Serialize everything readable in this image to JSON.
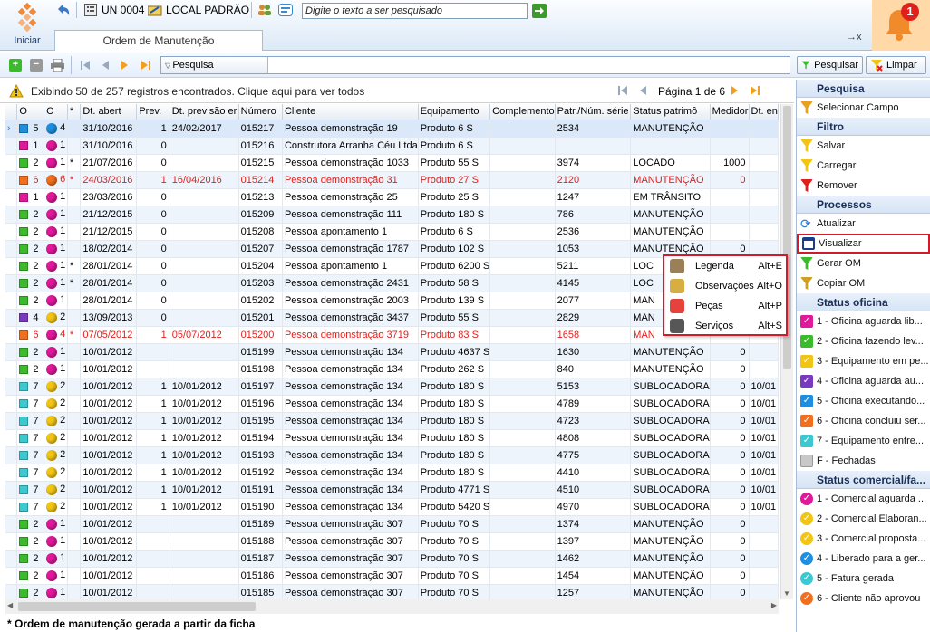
{
  "top": {
    "iniciar": "Iniciar",
    "unit": "UN 0004",
    "location": "LOCAL PADRÃO",
    "search_placeholder": "Digite o texto a ser pesquisado",
    "tab": "Ordem de Manutenção",
    "notif_count": "1",
    "tab_controls": "→x"
  },
  "toolbar": {
    "search_label": "Pesquisa",
    "search_btn": "Pesquisar",
    "clear_btn": "Limpar"
  },
  "info": {
    "text": "Exibindo 50 de 257 registros encontrados. Clique aqui para ver todos",
    "page": "Página 1 de 6"
  },
  "columns": [
    "O",
    "C",
    "*",
    "Dt. abert",
    "Prev.",
    "Dt. previsão er",
    "Número",
    "Cliente",
    "Equipamento",
    "Complemento",
    "Patr./Núm. série",
    "Status patrimô",
    "Medidor",
    "Dt. en"
  ],
  "colors": {
    "blue": "#1e8fe0",
    "magenta": "#e0189a",
    "green": "#3bbb2c",
    "orange": "#f07020",
    "purple": "#7a3ac0",
    "cyan": "#3cc8d0",
    "yellow": "#f2c514",
    "red": "#e0201b"
  },
  "rows": [
    {
      "o": "5",
      "oc": "blue",
      "c": "4",
      "cc": "blue",
      "star": "",
      "dt": "31/10/2016",
      "prev": "1",
      "dtp": "24/02/2017",
      "num": "015217",
      "cli": "Pessoa demonstração 19",
      "eq": "Produto 6 S",
      "comp": "",
      "patr": "2534",
      "status": "MANUTENÇÃO",
      "med": "",
      "dte": "",
      "sel": true
    },
    {
      "o": "1",
      "oc": "magenta",
      "c": "1",
      "cc": "magenta",
      "star": "",
      "dt": "31/10/2016",
      "prev": "0",
      "dtp": "",
      "num": "015216",
      "cli": "Construtora Arranha Céu Ltda",
      "eq": "Produto 6 S",
      "comp": "",
      "patr": "",
      "status": "",
      "med": "",
      "dte": ""
    },
    {
      "o": "2",
      "oc": "green",
      "c": "1",
      "cc": "magenta",
      "star": "*",
      "dt": "21/07/2016",
      "prev": "0",
      "dtp": "",
      "num": "015215",
      "cli": "Pessoa demonstração 1033",
      "eq": "Produto 55 S",
      "comp": "",
      "patr": "3974",
      "status": "LOCADO",
      "med": "1000",
      "dte": ""
    },
    {
      "o": "6",
      "oc": "orange",
      "c": "6",
      "cc": "orange",
      "star": "*",
      "dt": "24/03/2016",
      "prev": "1",
      "dtp": "16/04/2016",
      "num": "015214",
      "cli": "Pessoa demonstração 31",
      "eq": "Produto 27 S",
      "comp": "",
      "patr": "2120",
      "status": "MANUTENÇÃO",
      "med": "0",
      "dte": "",
      "red": true
    },
    {
      "o": "1",
      "oc": "magenta",
      "c": "1",
      "cc": "magenta",
      "star": "",
      "dt": "23/03/2016",
      "prev": "0",
      "dtp": "",
      "num": "015213",
      "cli": "Pessoa demonstração 25",
      "eq": "Produto 25 S",
      "comp": "",
      "patr": "1247",
      "status": "EM TRÂNSITO",
      "med": "",
      "dte": ""
    },
    {
      "o": "2",
      "oc": "green",
      "c": "1",
      "cc": "magenta",
      "star": "",
      "dt": "21/12/2015",
      "prev": "0",
      "dtp": "",
      "num": "015209",
      "cli": "Pessoa demonstração 111",
      "eq": "Produto 180 S",
      "comp": "",
      "patr": "786",
      "status": "MANUTENÇÃO",
      "med": "",
      "dte": ""
    },
    {
      "o": "2",
      "oc": "green",
      "c": "1",
      "cc": "magenta",
      "star": "",
      "dt": "21/12/2015",
      "prev": "0",
      "dtp": "",
      "num": "015208",
      "cli": "Pessoa apontamento 1",
      "eq": "Produto 6 S",
      "comp": "",
      "patr": "2536",
      "status": "MANUTENÇÃO",
      "med": "",
      "dte": ""
    },
    {
      "o": "2",
      "oc": "green",
      "c": "1",
      "cc": "magenta",
      "star": "",
      "dt": "18/02/2014",
      "prev": "0",
      "dtp": "",
      "num": "015207",
      "cli": "Pessoa demonstração 1787",
      "eq": "Produto 102 S",
      "comp": "",
      "patr": "1053",
      "status": "MANUTENÇÃO",
      "med": "0",
      "dte": ""
    },
    {
      "o": "2",
      "oc": "green",
      "c": "1",
      "cc": "magenta",
      "star": "*",
      "dt": "28/01/2014",
      "prev": "0",
      "dtp": "",
      "num": "015204",
      "cli": "Pessoa apontamento 1",
      "eq": "Produto 6200 S",
      "comp": "",
      "patr": "5211",
      "status": "LOC",
      "med": "",
      "dte": ""
    },
    {
      "o": "2",
      "oc": "green",
      "c": "1",
      "cc": "magenta",
      "star": "*",
      "dt": "28/01/2014",
      "prev": "0",
      "dtp": "",
      "num": "015203",
      "cli": "Pessoa demonstração 2431",
      "eq": "Produto 58 S",
      "comp": "",
      "patr": "4145",
      "status": "LOC",
      "med": "",
      "dte": ""
    },
    {
      "o": "2",
      "oc": "green",
      "c": "1",
      "cc": "magenta",
      "star": "",
      "dt": "28/01/2014",
      "prev": "0",
      "dtp": "",
      "num": "015202",
      "cli": "Pessoa demonstração 2003",
      "eq": "Produto 139 S",
      "comp": "",
      "patr": "2077",
      "status": "MAN",
      "med": "",
      "dte": ""
    },
    {
      "o": "4",
      "oc": "purple",
      "c": "2",
      "cc": "yellow",
      "star": "",
      "dt": "13/09/2013",
      "prev": "0",
      "dtp": "",
      "num": "015201",
      "cli": "Pessoa demonstração 3437",
      "eq": "Produto 55 S",
      "comp": "",
      "patr": "2829",
      "status": "MAN",
      "med": "",
      "dte": ""
    },
    {
      "o": "6",
      "oc": "orange",
      "c": "4",
      "cc": "magenta",
      "star": "*",
      "dt": "07/05/2012",
      "prev": "1",
      "dtp": "05/07/2012",
      "num": "015200",
      "cli": "Pessoa demonstração 3719",
      "eq": "Produto 83 S",
      "comp": "",
      "patr": "1658",
      "status": "MAN",
      "med": "",
      "dte": "",
      "red": true
    },
    {
      "o": "2",
      "oc": "green",
      "c": "1",
      "cc": "magenta",
      "star": "",
      "dt": "10/01/2012",
      "prev": "",
      "dtp": "",
      "num": "015199",
      "cli": "Pessoa demonstração 134",
      "eq": "Produto 4637 S",
      "comp": "",
      "patr": "1630",
      "status": "MANUTENÇÃO",
      "med": "0",
      "dte": ""
    },
    {
      "o": "2",
      "oc": "green",
      "c": "1",
      "cc": "magenta",
      "star": "",
      "dt": "10/01/2012",
      "prev": "",
      "dtp": "",
      "num": "015198",
      "cli": "Pessoa demonstração 134",
      "eq": "Produto 262 S",
      "comp": "",
      "patr": "840",
      "status": "MANUTENÇÃO",
      "med": "0",
      "dte": ""
    },
    {
      "o": "7",
      "oc": "cyan",
      "c": "2",
      "cc": "yellow",
      "star": "",
      "dt": "10/01/2012",
      "prev": "1",
      "dtp": "10/01/2012",
      "num": "015197",
      "cli": "Pessoa demonstração 134",
      "eq": "Produto 180 S",
      "comp": "",
      "patr": "5153",
      "status": "SUBLOCADORA",
      "med": "0",
      "dte": "10/01"
    },
    {
      "o": "7",
      "oc": "cyan",
      "c": "2",
      "cc": "yellow",
      "star": "",
      "dt": "10/01/2012",
      "prev": "1",
      "dtp": "10/01/2012",
      "num": "015196",
      "cli": "Pessoa demonstração 134",
      "eq": "Produto 180 S",
      "comp": "",
      "patr": "4789",
      "status": "SUBLOCADORA",
      "med": "0",
      "dte": "10/01"
    },
    {
      "o": "7",
      "oc": "cyan",
      "c": "2",
      "cc": "yellow",
      "star": "",
      "dt": "10/01/2012",
      "prev": "1",
      "dtp": "10/01/2012",
      "num": "015195",
      "cli": "Pessoa demonstração 134",
      "eq": "Produto 180 S",
      "comp": "",
      "patr": "4723",
      "status": "SUBLOCADORA",
      "med": "0",
      "dte": "10/01"
    },
    {
      "o": "7",
      "oc": "cyan",
      "c": "2",
      "cc": "yellow",
      "star": "",
      "dt": "10/01/2012",
      "prev": "1",
      "dtp": "10/01/2012",
      "num": "015194",
      "cli": "Pessoa demonstração 134",
      "eq": "Produto 180 S",
      "comp": "",
      "patr": "4808",
      "status": "SUBLOCADORA",
      "med": "0",
      "dte": "10/01"
    },
    {
      "o": "7",
      "oc": "cyan",
      "c": "2",
      "cc": "yellow",
      "star": "",
      "dt": "10/01/2012",
      "prev": "1",
      "dtp": "10/01/2012",
      "num": "015193",
      "cli": "Pessoa demonstração 134",
      "eq": "Produto 180 S",
      "comp": "",
      "patr": "4775",
      "status": "SUBLOCADORA",
      "med": "0",
      "dte": "10/01"
    },
    {
      "o": "7",
      "oc": "cyan",
      "c": "2",
      "cc": "yellow",
      "star": "",
      "dt": "10/01/2012",
      "prev": "1",
      "dtp": "10/01/2012",
      "num": "015192",
      "cli": "Pessoa demonstração 134",
      "eq": "Produto 180 S",
      "comp": "",
      "patr": "4410",
      "status": "SUBLOCADORA",
      "med": "0",
      "dte": "10/01"
    },
    {
      "o": "7",
      "oc": "cyan",
      "c": "2",
      "cc": "yellow",
      "star": "",
      "dt": "10/01/2012",
      "prev": "1",
      "dtp": "10/01/2012",
      "num": "015191",
      "cli": "Pessoa demonstração 134",
      "eq": "Produto 4771 S",
      "comp": "",
      "patr": "4510",
      "status": "SUBLOCADORA",
      "med": "0",
      "dte": "10/01"
    },
    {
      "o": "7",
      "oc": "cyan",
      "c": "2",
      "cc": "yellow",
      "star": "",
      "dt": "10/01/2012",
      "prev": "1",
      "dtp": "10/01/2012",
      "num": "015190",
      "cli": "Pessoa demonstração 134",
      "eq": "Produto 5420 S",
      "comp": "",
      "patr": "4970",
      "status": "SUBLOCADORA",
      "med": "0",
      "dte": "10/01"
    },
    {
      "o": "2",
      "oc": "green",
      "c": "1",
      "cc": "magenta",
      "star": "",
      "dt": "10/01/2012",
      "prev": "",
      "dtp": "",
      "num": "015189",
      "cli": "Pessoa demonstração 307",
      "eq": "Produto 70 S",
      "comp": "",
      "patr": "1374",
      "status": "MANUTENÇÃO",
      "med": "0",
      "dte": ""
    },
    {
      "o": "2",
      "oc": "green",
      "c": "1",
      "cc": "magenta",
      "star": "",
      "dt": "10/01/2012",
      "prev": "",
      "dtp": "",
      "num": "015188",
      "cli": "Pessoa demonstração 307",
      "eq": "Produto 70 S",
      "comp": "",
      "patr": "1397",
      "status": "MANUTENÇÃO",
      "med": "0",
      "dte": ""
    },
    {
      "o": "2",
      "oc": "green",
      "c": "1",
      "cc": "magenta",
      "star": "",
      "dt": "10/01/2012",
      "prev": "",
      "dtp": "",
      "num": "015187",
      "cli": "Pessoa demonstração 307",
      "eq": "Produto 70 S",
      "comp": "",
      "patr": "1462",
      "status": "MANUTENÇÃO",
      "med": "0",
      "dte": ""
    },
    {
      "o": "2",
      "oc": "green",
      "c": "1",
      "cc": "magenta",
      "star": "",
      "dt": "10/01/2012",
      "prev": "",
      "dtp": "",
      "num": "015186",
      "cli": "Pessoa demonstração 307",
      "eq": "Produto 70 S",
      "comp": "",
      "patr": "1454",
      "status": "MANUTENÇÃO",
      "med": "0",
      "dte": ""
    },
    {
      "o": "2",
      "oc": "green",
      "c": "1",
      "cc": "magenta",
      "star": "",
      "dt": "10/01/2012",
      "prev": "",
      "dtp": "",
      "num": "015185",
      "cli": "Pessoa demonstração 307",
      "eq": "Produto 70 S",
      "comp": "",
      "patr": "1257",
      "status": "MANUTENÇÃO",
      "med": "0",
      "dte": ""
    }
  ],
  "footer": "* Ordem de manutenção gerada a partir da ficha",
  "panel": {
    "sections": [
      {
        "title": "Pesquisa",
        "items": [
          {
            "label": "Selecionar Campo",
            "icon": "select-field-icon",
            "color": "#e8a020"
          }
        ]
      },
      {
        "title": "Filtro",
        "items": [
          {
            "label": "Salvar",
            "icon": "filter-save-icon",
            "color": "#f2c514"
          },
          {
            "label": "Carregar",
            "icon": "filter-load-icon",
            "color": "#f2c514"
          },
          {
            "label": "Remover",
            "icon": "filter-remove-icon",
            "color": "#e0201b"
          }
        ]
      },
      {
        "title": "Processos",
        "items": [
          {
            "label": "Atualizar",
            "icon": "refresh-icon",
            "color": "#2a7ad8"
          },
          {
            "label": "Visualizar",
            "icon": "view-icon",
            "color": "#1a3c8e",
            "highlight": true
          },
          {
            "label": "Gerar OM",
            "icon": "generate-om-icon",
            "color": "#3bbb2c"
          },
          {
            "label": "Copiar OM",
            "icon": "copy-om-icon",
            "color": "#d0a020"
          }
        ]
      },
      {
        "title": "Status oficina",
        "items": [
          {
            "label": "1 - Oficina aguarda lib...",
            "icon": "check-icon",
            "color": "#e0189a"
          },
          {
            "label": "2 - Oficina fazendo lev...",
            "icon": "check-icon",
            "color": "#3bbb2c"
          },
          {
            "label": "3 - Equipamento em pe...",
            "icon": "check-icon",
            "color": "#f2c514"
          },
          {
            "label": "4 - Oficina aguarda au...",
            "icon": "check-icon",
            "color": "#7a3ac0"
          },
          {
            "label": "5 - Oficina executando...",
            "icon": "check-icon",
            "color": "#1e8fe0"
          },
          {
            "label": "6 - Oficina concluiu ser...",
            "icon": "check-icon",
            "color": "#f07020"
          },
          {
            "label": "7 - Equipamento entre...",
            "icon": "check-icon",
            "color": "#3cc8d0"
          },
          {
            "label": "F - Fechadas",
            "icon": "square-icon",
            "color": "#c8c8c8"
          }
        ]
      },
      {
        "title": "Status comercial/fa...",
        "items": [
          {
            "label": "1 - Comercial aguarda ...",
            "icon": "check-ball-icon",
            "color": "#e0189a"
          },
          {
            "label": "2 - Comercial Elaboran...",
            "icon": "check-ball-icon",
            "color": "#f2c514"
          },
          {
            "label": "3 - Comercial proposta...",
            "icon": "check-ball-icon",
            "color": "#f2c514"
          },
          {
            "label": "4 - Liberado para a ger...",
            "icon": "check-ball-icon",
            "color": "#1e8fe0"
          },
          {
            "label": "5 - Fatura gerada",
            "icon": "check-ball-icon",
            "color": "#3cc8d0"
          },
          {
            "label": "6 - Cliente não aprovou",
            "icon": "check-ball-icon",
            "color": "#f07020"
          }
        ]
      }
    ]
  },
  "context_menu": [
    {
      "label": "Legenda",
      "shortcut": "Alt+E",
      "icon": "legend-icon"
    },
    {
      "label": "Observações",
      "shortcut": "Alt+O",
      "icon": "notes-icon"
    },
    {
      "label": "Peças",
      "shortcut": "Alt+P",
      "icon": "parts-icon"
    },
    {
      "label": "Serviços",
      "shortcut": "Alt+S",
      "icon": "services-icon"
    }
  ]
}
